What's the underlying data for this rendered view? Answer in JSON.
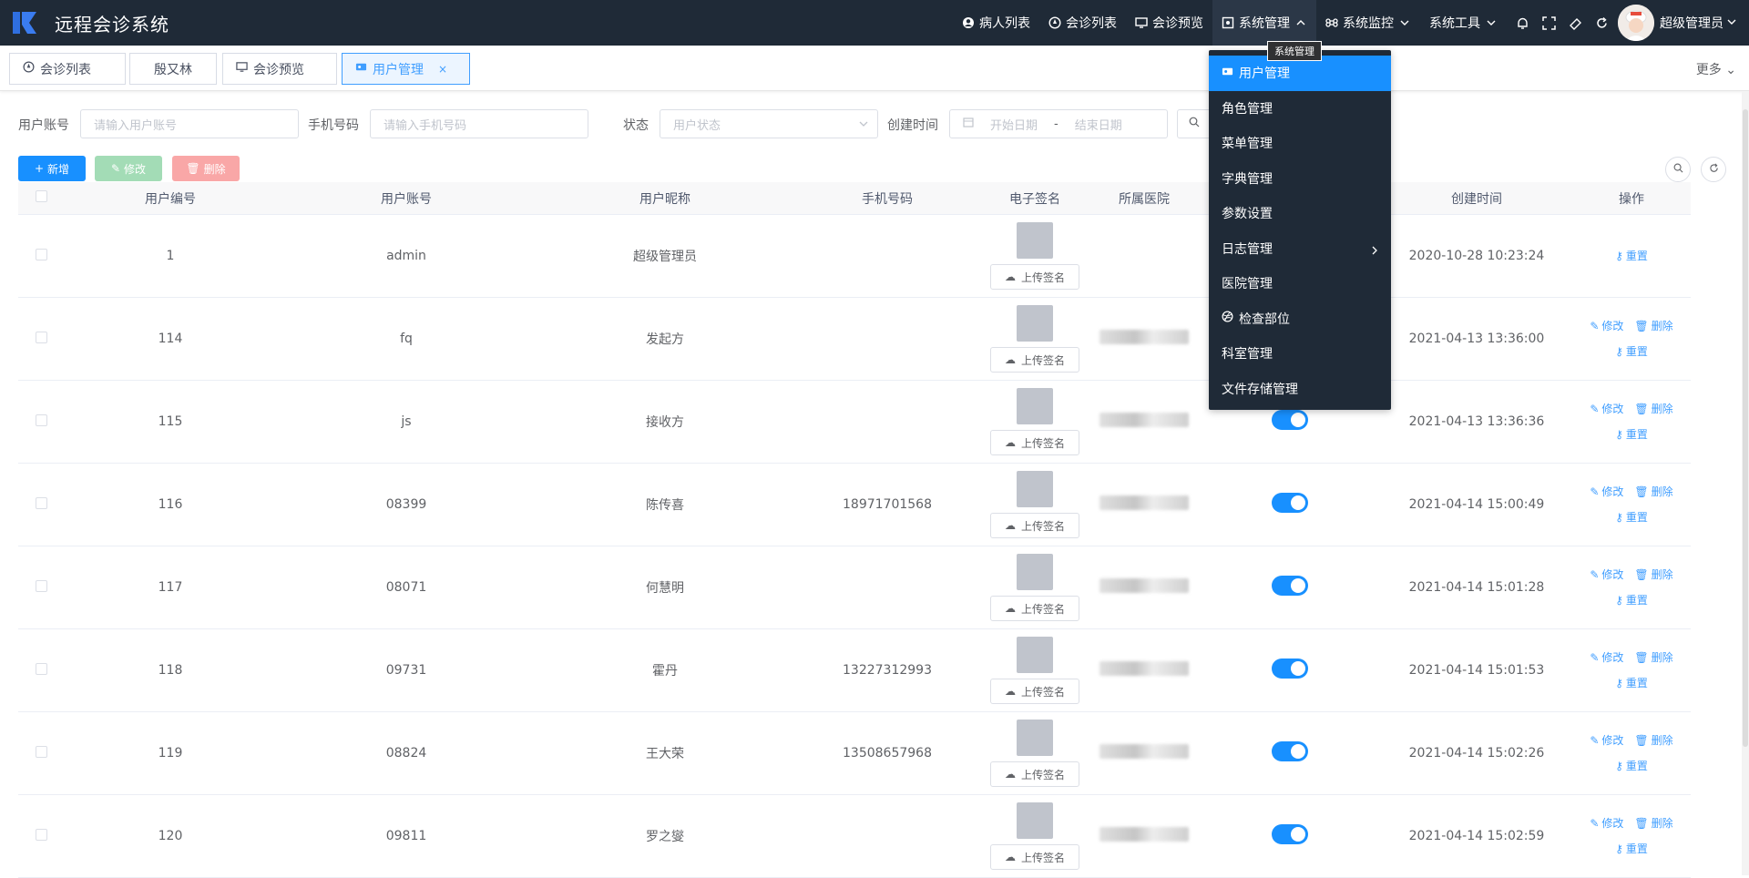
{
  "app": {
    "title": "远程会诊系统"
  },
  "navbar": {
    "items": [
      {
        "label": "病人列表",
        "icon": "user-circle-icon"
      },
      {
        "label": "会诊列表",
        "icon": "compass-icon"
      },
      {
        "label": "会诊预览",
        "icon": "monitor-icon"
      },
      {
        "label": "系统管理",
        "icon": "system-icon",
        "active": true
      },
      {
        "label": "系统监控",
        "icon": "command-icon"
      },
      {
        "label": "系统工具",
        "icon": ""
      }
    ],
    "user": "超级管理员"
  },
  "tags": [
    {
      "label": "会诊列表"
    },
    {
      "label": "殷又林"
    },
    {
      "label": "会诊预览"
    },
    {
      "label": "用户管理",
      "active": true,
      "close": "×"
    }
  ],
  "more_label": "更多",
  "search": {
    "account_label": "用户账号",
    "account_placeholder": "请输入用户账号",
    "phone_label": "手机号码",
    "phone_placeholder": "请输入手机号码",
    "status_label": "状态",
    "status_placeholder": "用户状态",
    "created_label": "创建时间",
    "start_placeholder": "开始日期",
    "date_sep": "-",
    "end_placeholder": "结束日期"
  },
  "toolbar": {
    "add": "新增",
    "edit": "修改",
    "delete": "删除"
  },
  "table": {
    "headers": [
      "用户编号",
      "用户账号",
      "用户昵称",
      "手机号码",
      "电子签名",
      "所属医院",
      "",
      "创建时间",
      "操作"
    ],
    "upload_label": "上传签名",
    "edit_label": "修改",
    "delete_label": "删除",
    "reset_label": "重置",
    "rows": [
      {
        "id": "1",
        "account": "admin",
        "nickname": "超级管理员",
        "phone": "",
        "created": "2020-10-28 10:23:24",
        "admin": true
      },
      {
        "id": "114",
        "account": "fq",
        "nickname": "发起方",
        "phone": "",
        "created": "2021-04-13 13:36:00"
      },
      {
        "id": "115",
        "account": "js",
        "nickname": "接收方",
        "phone": "",
        "created": "2021-04-13 13:36:36"
      },
      {
        "id": "116",
        "account": "08399",
        "nickname": "陈传喜",
        "phone": "18971701568",
        "created": "2021-04-14 15:00:49"
      },
      {
        "id": "117",
        "account": "08071",
        "nickname": "何慧明",
        "phone": "",
        "created": "2021-04-14 15:01:28"
      },
      {
        "id": "118",
        "account": "09731",
        "nickname": "霍丹",
        "phone": "13227312993",
        "created": "2021-04-14 15:01:53"
      },
      {
        "id": "119",
        "account": "08824",
        "nickname": "王大荣",
        "phone": "13508657968",
        "created": "2021-04-14 15:02:26"
      },
      {
        "id": "120",
        "account": "09811",
        "nickname": "罗之燮",
        "phone": "",
        "created": "2021-04-14 15:02:59"
      }
    ]
  },
  "dropdown": {
    "tooltip": "系统管理",
    "items": [
      {
        "label": "用户管理",
        "active": true
      },
      {
        "label": "角色管理"
      },
      {
        "label": "菜单管理"
      },
      {
        "label": "字典管理"
      },
      {
        "label": "参数设置"
      },
      {
        "label": "日志管理",
        "submenu": true
      },
      {
        "label": "医院管理"
      },
      {
        "label": "检查部位",
        "icon": "dribbble-icon"
      },
      {
        "label": "科室管理"
      },
      {
        "label": "文件存储管理"
      }
    ]
  },
  "colors": {
    "navbar_bg": "#1f2a37",
    "primary": "#1890ff",
    "success_light": "#a3dcb6",
    "danger_light": "#f9a7a7"
  }
}
